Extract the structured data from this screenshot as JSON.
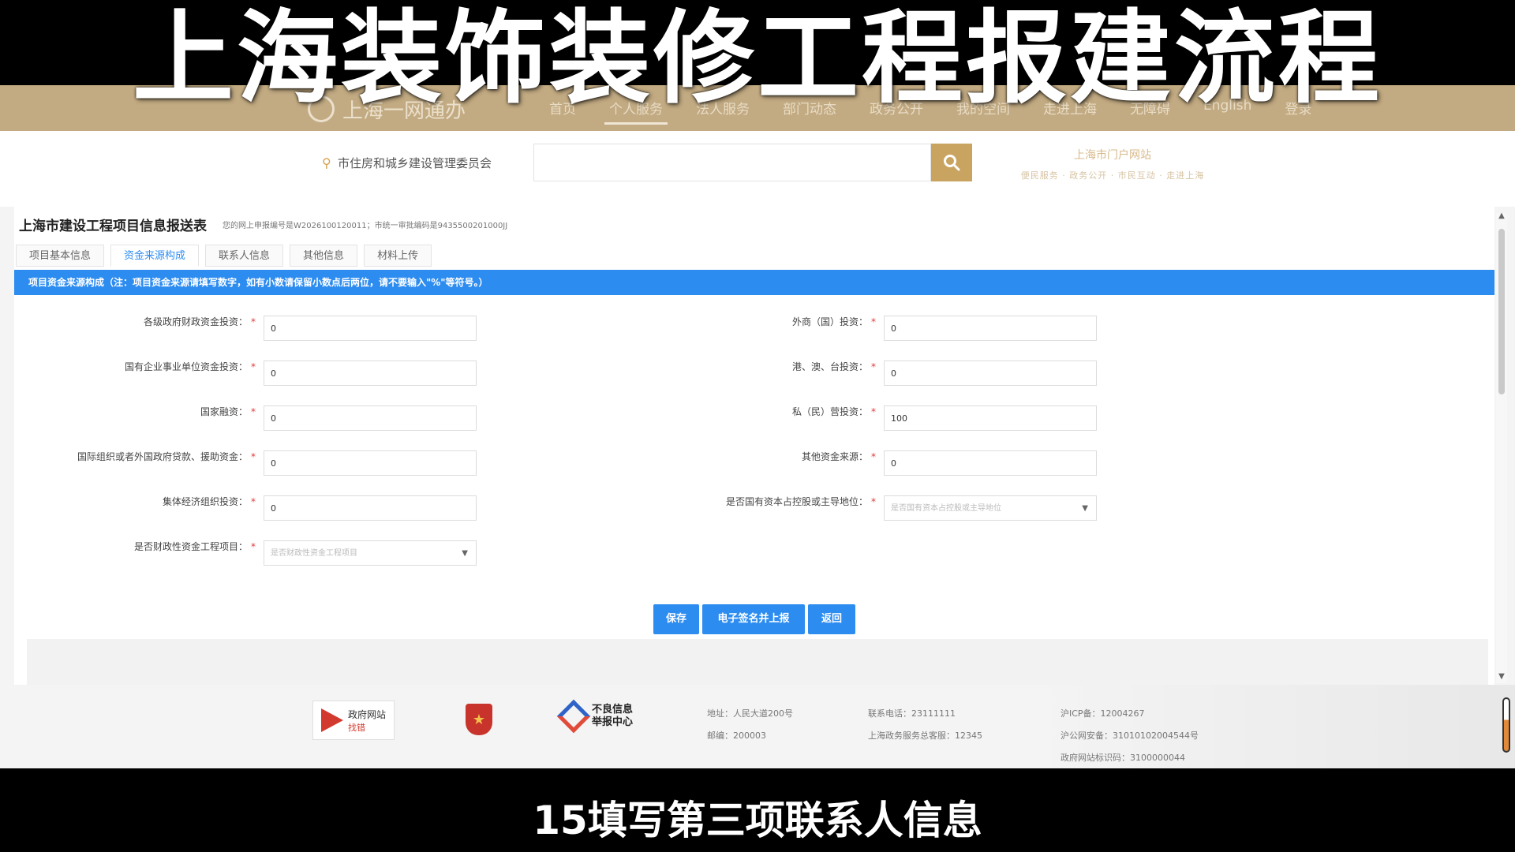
{
  "video": {
    "title": "上海装饰装修工程报建流程",
    "subtitle": "15填写第三项联系人信息"
  },
  "site_nav": {
    "logo_text": "上海一网通办",
    "items": [
      "首页",
      "个人服务",
      "法人服务",
      "部门动态",
      "政务公开",
      "我的空间",
      "走进上海",
      "无障碍",
      "English",
      "登录"
    ],
    "active_index": 1
  },
  "search": {
    "location": "市住房和城乡建设管理委员会",
    "placeholder": "",
    "brand": "上海市门户网站",
    "brand_sub": "便民服务 · 政务公开 · 市民互动 · 走进上海"
  },
  "form": {
    "title": "上海市建设工程项目信息报送表",
    "subtitle": "您的网上申报编号是W2026100120011；市统一审批编码是9435500201000JJ",
    "tabs": [
      "项目基本信息",
      "资金来源构成",
      "联系人信息",
      "其他信息",
      "材料上传"
    ],
    "active_tab": 1,
    "notice": "项目资金来源构成（注：项目资金来源请填写数字，如有小数请保留小数点后两位，请不要输入\"%\"等符号。）",
    "left_fields": [
      {
        "label": "各级政府财政资金投资：",
        "value": "0"
      },
      {
        "label": "国有企业事业单位资金投资：",
        "value": "0"
      },
      {
        "label": "国家融资：",
        "value": "0"
      },
      {
        "label": "国际组织或者外国政府贷款、援助资金：",
        "value": "0"
      },
      {
        "label": "集体经济组织投资：",
        "value": "0"
      }
    ],
    "right_fields": [
      {
        "label": "外商（国）投资：",
        "value": "0"
      },
      {
        "label": "港、澳、台投资：",
        "value": "0"
      },
      {
        "label": "私（民）营投资：",
        "value": "100"
      },
      {
        "label": "其他资金来源：",
        "value": "0"
      }
    ],
    "select_left": {
      "label": "是否财政性资金工程项目：",
      "placeholder": "是否财政性资金工程项目"
    },
    "select_right": {
      "label": "是否国有资本占控股或主导地位：",
      "placeholder": "是否国有资本占控股或主导地位"
    },
    "buttons": {
      "save": "保存",
      "sign": "电子签名并上报",
      "back": "返回"
    }
  },
  "footer": {
    "logo1_title": "政府网站",
    "logo1_sub": "找错",
    "logo3": "不良信息举报中心",
    "address": "地址：人民大道200号",
    "postcode": "邮编：200003",
    "phone": "联系电话：23111111",
    "hotline": "上海政务服务总客服：12345",
    "icp": "沪ICP备：12004267",
    "police": "沪公网安备：31010102004544号",
    "gov_id": "政府网站标识码：3100000044"
  },
  "colors": {
    "primary": "#2d8cf0",
    "nav_gold": "#c2aa82",
    "search_gold": "#c9a461",
    "required": "#e23b3b"
  }
}
